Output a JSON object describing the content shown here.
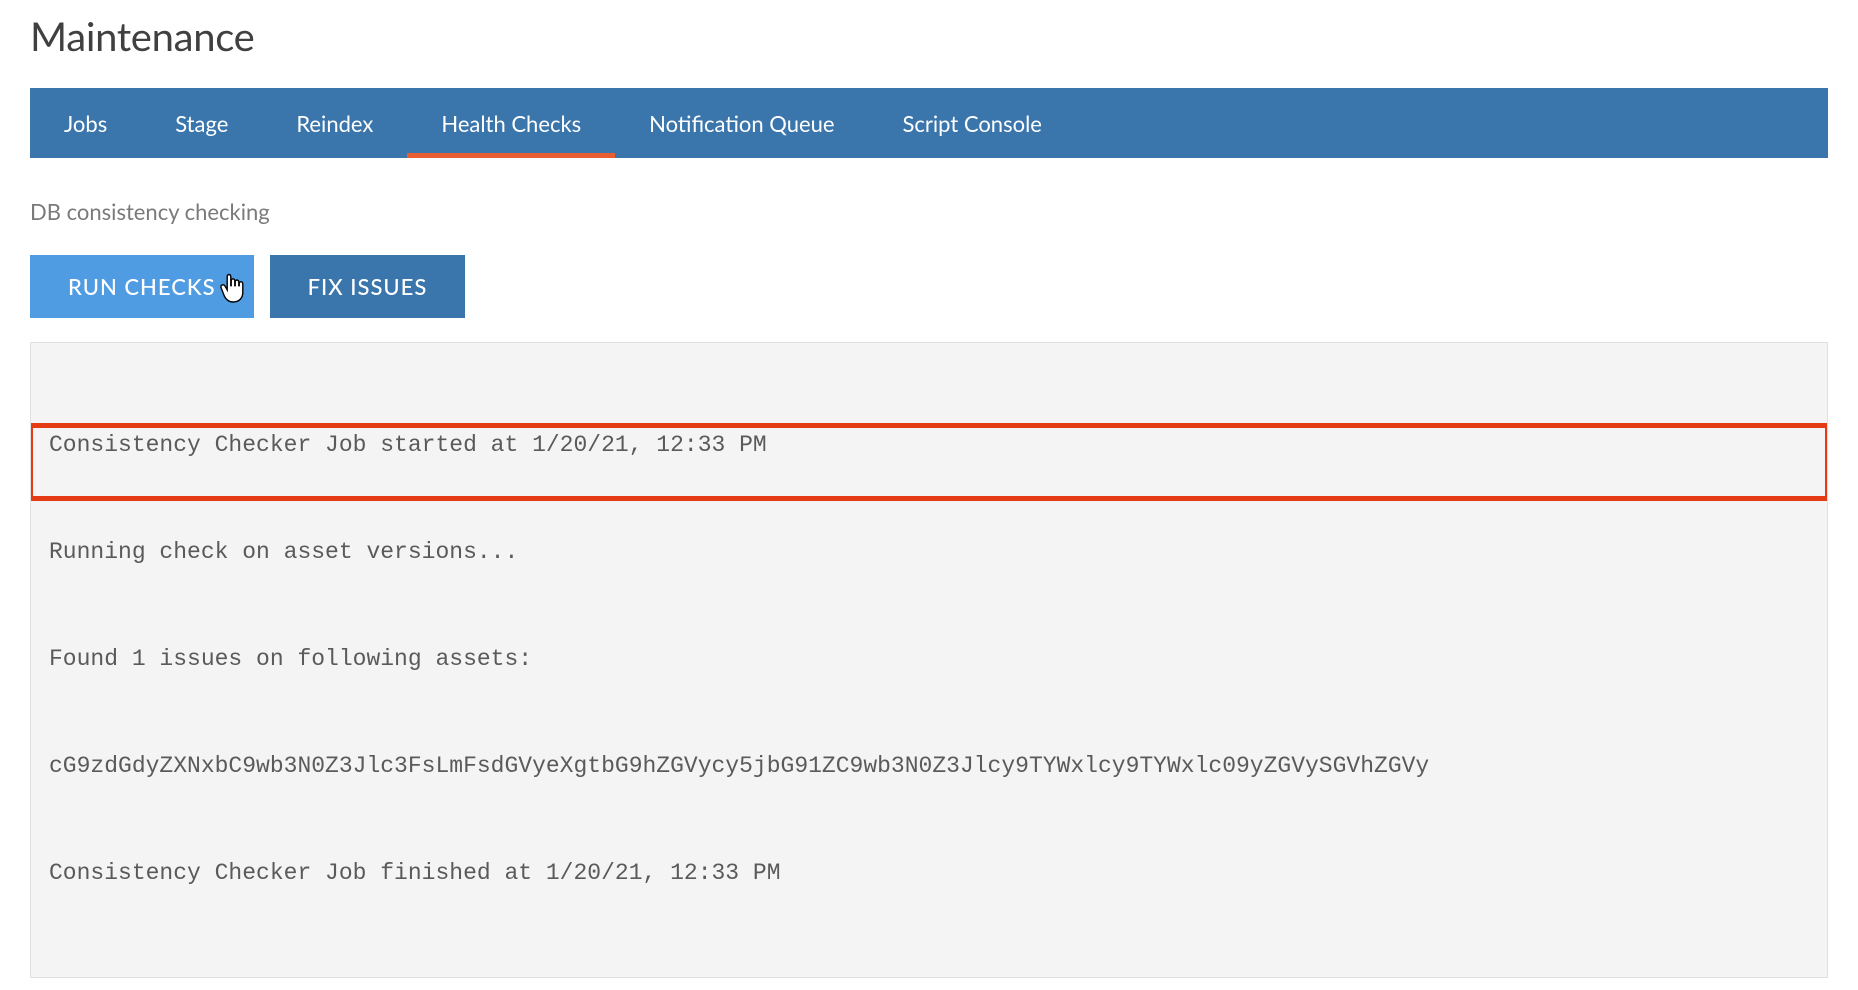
{
  "page": {
    "title": "Maintenance"
  },
  "tabs": [
    {
      "label": "Jobs"
    },
    {
      "label": "Stage"
    },
    {
      "label": "Reindex"
    },
    {
      "label": "Health Checks",
      "active": true
    },
    {
      "label": "Notification Queue"
    },
    {
      "label": "Script Console"
    }
  ],
  "section": {
    "subtitle": "DB consistency checking",
    "buttons": {
      "run": "RUN CHECKS",
      "fix": "FIX ISSUES"
    }
  },
  "console": {
    "lines": [
      "Consistency Checker Job started at 1/20/21, 12:33 PM",
      "Running check on asset versions...",
      "Found 1 issues on following assets:",
      "cG9zdGdyZXNxbC9wb3N0Z3Jlc3FsLmFsdGVyeXgtbG9hZGVycy5jbG91ZC9wb3N0Z3Jlcy9TYWxlcy9TYWxlc09yZGVySGVhZGVy",
      "Consistency Checker Job finished at 1/20/21, 12:33 PM"
    ],
    "highlight_start": 2,
    "highlight_end": 3
  }
}
